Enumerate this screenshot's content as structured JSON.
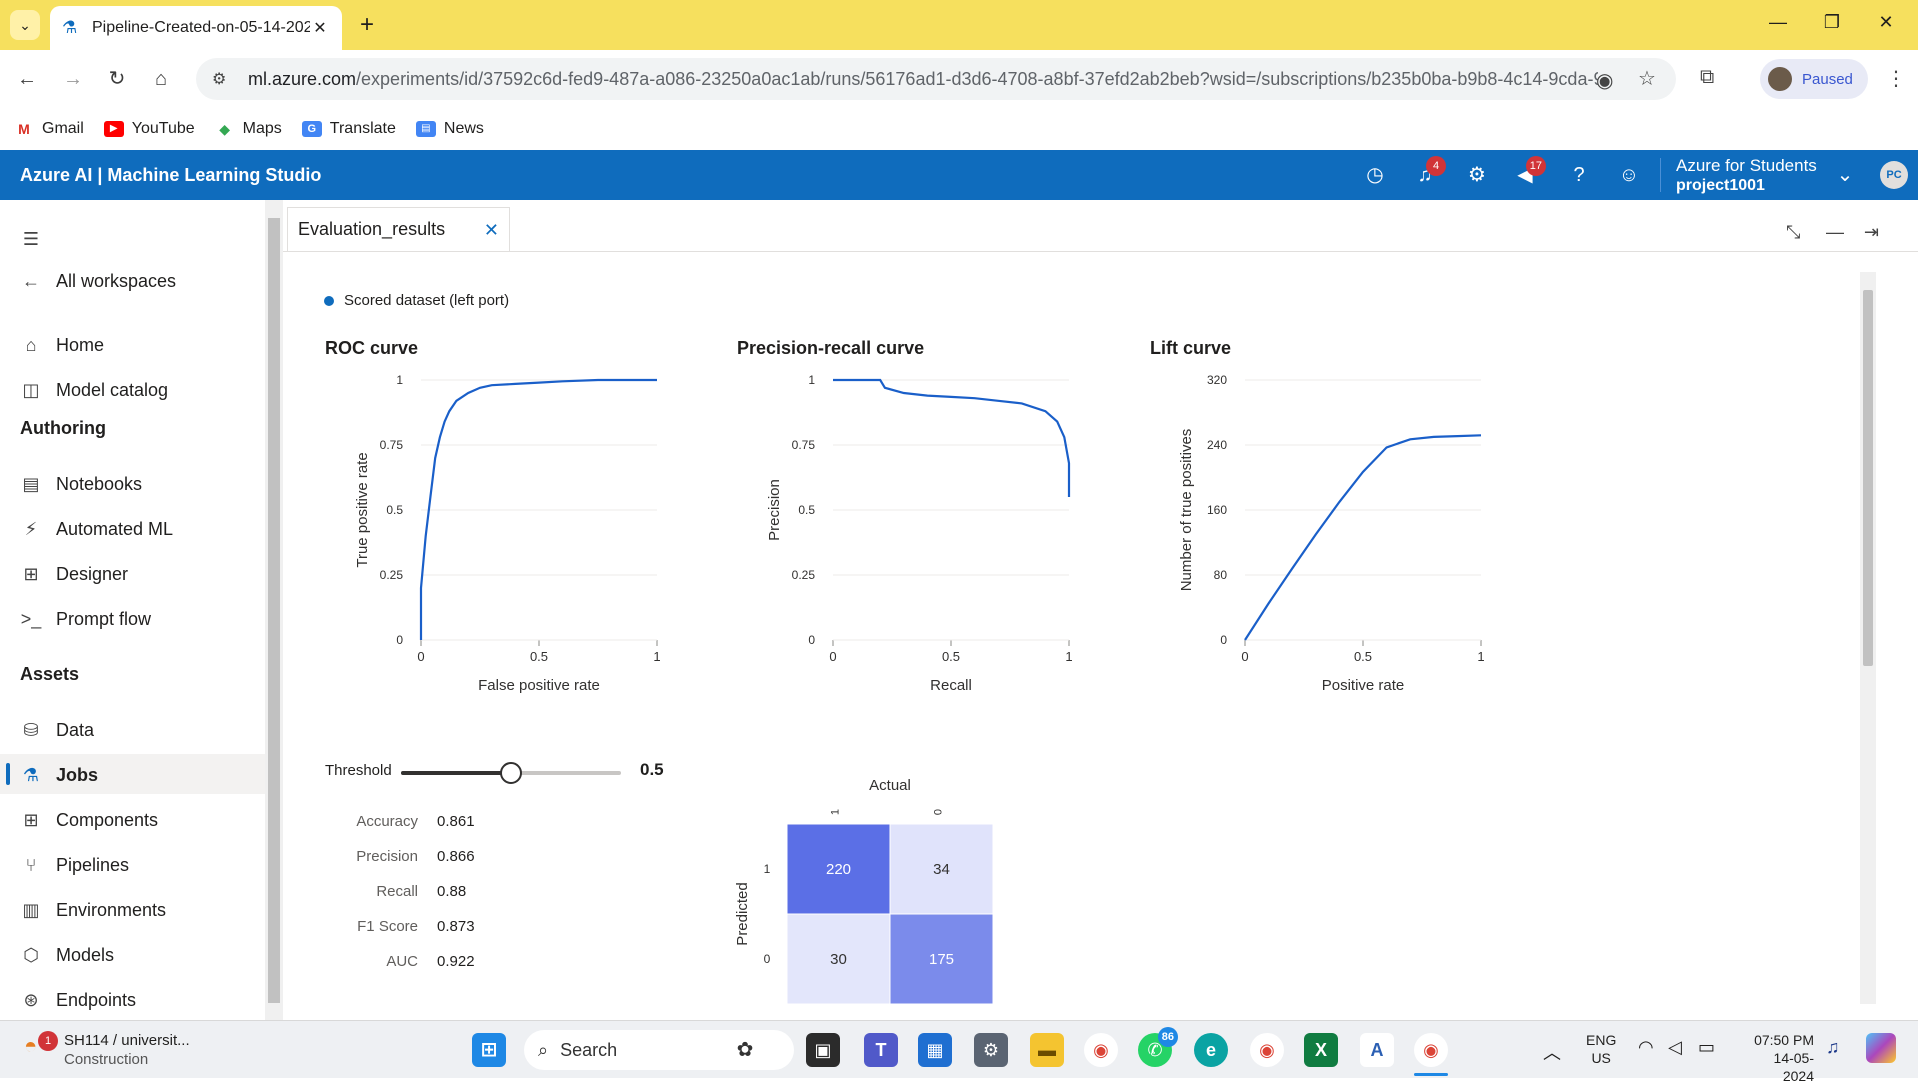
{
  "browser": {
    "tab_title": "Pipeline-Created-on-05-14-202",
    "tab_close": "✕",
    "new_tab": "+",
    "url_domain": "ml.azure.com",
    "url_path": "/experiments/id/37592c6d-fed9-487a-a086-23250a0ac1ab/runs/56176ad1-d3d6-4708-a8bf-37efd2ab2beb?wsid=/subscriptions/b235b0ba-b9b8-4c14-9cda-94...",
    "profile_label": "Paused",
    "bookmarks": [
      "Gmail",
      "YouTube",
      "Maps",
      "Translate",
      "News"
    ]
  },
  "app": {
    "brand": "Azure AI | Machine Learning Studio",
    "notifications_count": "4",
    "announcements_count": "17",
    "account_name": "Azure for Students",
    "workspace_name": "project1001",
    "avatar_initials": "PC"
  },
  "sidebar": {
    "back_label": "All workspaces",
    "home": "Home",
    "model_catalog": "Model catalog",
    "authoring_header": "Authoring",
    "notebooks": "Notebooks",
    "automated_ml": "Automated ML",
    "designer": "Designer",
    "prompt_flow": "Prompt flow",
    "assets_header": "Assets",
    "data": "Data",
    "jobs": "Jobs",
    "components": "Components",
    "pipelines": "Pipelines",
    "environments": "Environments",
    "models": "Models",
    "endpoints": "Endpoints"
  },
  "panel": {
    "tab_title": "Evaluation_results",
    "legend": "Scored dataset (left port)"
  },
  "charts": {
    "roc": {
      "title": "ROC curve",
      "xlabel": "False positive rate",
      "ylabel": "True positive rate"
    },
    "pr": {
      "title": "Precision-recall curve",
      "xlabel": "Recall",
      "ylabel": "Precision"
    },
    "lift": {
      "title": "Lift curve",
      "xlabel": "Positive rate",
      "ylabel": "Number of true positives"
    }
  },
  "chart_data": [
    {
      "type": "line",
      "title": "ROC curve",
      "xlabel": "False positive rate",
      "ylabel": "True positive rate",
      "xlim": [
        0,
        1
      ],
      "ylim": [
        0,
        1
      ],
      "x_ticks": [
        "0",
        "0.5",
        "1"
      ],
      "y_ticks": [
        "0",
        "0.25",
        "0.5",
        "0.75",
        "1"
      ],
      "x": [
        0,
        0.0,
        0.02,
        0.04,
        0.06,
        0.08,
        0.1,
        0.12,
        0.15,
        0.2,
        0.25,
        0.3,
        0.4,
        0.5,
        0.6,
        0.75,
        0.8,
        1.0
      ],
      "y": [
        0,
        0.2,
        0.4,
        0.55,
        0.7,
        0.78,
        0.84,
        0.88,
        0.92,
        0.95,
        0.97,
        0.98,
        0.985,
        0.99,
        0.995,
        1.0,
        1.0,
        1.0
      ]
    },
    {
      "type": "line",
      "title": "Precision-recall curve",
      "xlabel": "Recall",
      "ylabel": "Precision",
      "xlim": [
        0,
        1
      ],
      "ylim": [
        0,
        1
      ],
      "x_ticks": [
        "0",
        "0.5",
        "1"
      ],
      "y_ticks": [
        "0",
        "0.25",
        "0.5",
        "0.75",
        "1"
      ],
      "x": [
        0,
        0.2,
        0.22,
        0.3,
        0.4,
        0.5,
        0.6,
        0.7,
        0.8,
        0.9,
        0.95,
        0.98,
        1.0,
        1.0
      ],
      "y": [
        1.0,
        1.0,
        0.97,
        0.95,
        0.94,
        0.935,
        0.93,
        0.92,
        0.91,
        0.88,
        0.84,
        0.78,
        0.68,
        0.55
      ]
    },
    {
      "type": "line",
      "title": "Lift curve",
      "xlabel": "Positive rate",
      "ylabel": "Number of true positives",
      "xlim": [
        0,
        1
      ],
      "ylim": [
        0,
        320
      ],
      "x_ticks": [
        "0",
        "0.5",
        "1"
      ],
      "y_ticks": [
        "0",
        "80",
        "160",
        "240",
        "320"
      ],
      "x": [
        0,
        0.1,
        0.2,
        0.3,
        0.4,
        0.5,
        0.6,
        0.7,
        0.8,
        0.9,
        1.0
      ],
      "y": [
        0,
        45,
        88,
        130,
        170,
        207,
        237,
        247,
        250,
        251,
        252
      ]
    },
    {
      "type": "heatmap",
      "title": "Actual",
      "ylabel": "Predicted",
      "x_categories": [
        "1",
        "0"
      ],
      "y_categories": [
        "1",
        "0"
      ],
      "values": [
        [
          220,
          34
        ],
        [
          30,
          175
        ]
      ]
    }
  ],
  "threshold": {
    "label": "Threshold",
    "value": 0.5,
    "value_text": "0.5"
  },
  "metrics": [
    {
      "label": "Accuracy",
      "value": "0.861"
    },
    {
      "label": "Precision",
      "value": "0.866"
    },
    {
      "label": "Recall",
      "value": "0.88"
    },
    {
      "label": "F1 Score",
      "value": "0.873"
    },
    {
      "label": "AUC",
      "value": "0.922"
    }
  ],
  "confusion": {
    "actual_label": "Actual",
    "predicted_label": "Predicted",
    "col_labels": [
      "1",
      "0"
    ],
    "row_labels": [
      "1",
      "0"
    ],
    "cells": [
      "220",
      "34",
      "30",
      "175"
    ],
    "colors": {
      "high": "#5b6fe6",
      "low": "#e3e6fb"
    }
  },
  "taskbar": {
    "weather_title": "SH114 / universit...",
    "weather_sub": "Construction",
    "weather_badge": "1",
    "search_placeholder": "Search",
    "whatsapp_badge": "86",
    "lang_top": "ENG",
    "lang_bottom": "US",
    "time": "07:50 PM",
    "date": "14-05-2024"
  },
  "colors": {
    "azure_blue": "#0f6cbd",
    "chrome_yellow": "#f6e05e",
    "line_blue": "#1a5fc9"
  }
}
